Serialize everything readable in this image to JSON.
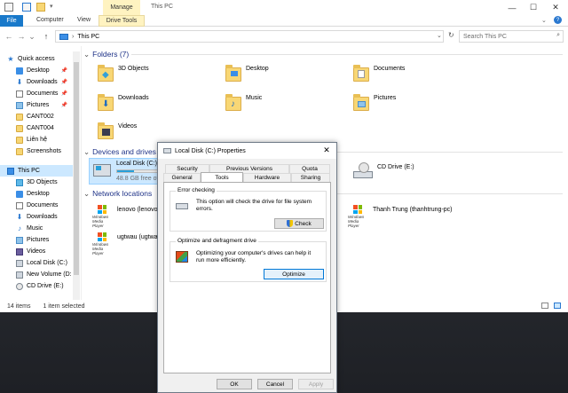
{
  "window": {
    "title": "This PC",
    "manage_label": "Manage",
    "tabs": {
      "file": "File",
      "computer": "Computer",
      "view": "View",
      "drive_tools": "Drive Tools"
    },
    "controls": {
      "minimize": "—",
      "maximize": "☐",
      "close": "✕"
    }
  },
  "nav": {
    "back": "←",
    "forward": "→",
    "recent": "⌄",
    "up": "↑",
    "address_sep": "›",
    "address": "This PC",
    "dropdown": "⌄",
    "refresh": "↻",
    "search_placeholder": "Search This PC"
  },
  "sidebar": {
    "items": [
      {
        "label": "Quick access"
      },
      {
        "label": "Desktop",
        "pin": "📌"
      },
      {
        "label": "Downloads",
        "pin": "📌"
      },
      {
        "label": "Documents",
        "pin": "📌"
      },
      {
        "label": "Pictures",
        "pin": "📌"
      },
      {
        "label": "CANT002"
      },
      {
        "label": "CANT004"
      },
      {
        "label": "Liên hệ"
      },
      {
        "label": "Screenshots"
      },
      {
        "label": "This PC"
      },
      {
        "label": "3D Objects"
      },
      {
        "label": "Desktop"
      },
      {
        "label": "Documents"
      },
      {
        "label": "Downloads"
      },
      {
        "label": "Music"
      },
      {
        "label": "Pictures"
      },
      {
        "label": "Videos"
      },
      {
        "label": "Local Disk (C:)"
      },
      {
        "label": "New Volume (D:"
      },
      {
        "label": "CD Drive (E:)"
      }
    ]
  },
  "content": {
    "folders_header": "Folders (7)",
    "folders": [
      {
        "label": "3D Objects"
      },
      {
        "label": "Desktop"
      },
      {
        "label": "Documents"
      },
      {
        "label": "Downloads"
      },
      {
        "label": "Music"
      },
      {
        "label": "Pictures"
      },
      {
        "label": "Videos"
      }
    ],
    "devices_header": "Devices and drives",
    "drives": [
      {
        "label": "Local Disk (C:)",
        "free": "48.8 GB free of",
        "used_fraction": 0.42
      },
      {
        "label": "CD Drive (E:)"
      }
    ],
    "network_header": "Network locations",
    "network": [
      {
        "label": "lenovo (lenovo"
      },
      {
        "label": "ugtwau (ugtwa"
      },
      {
        "label": "Thanh Trung (thanhtrung-pc)"
      }
    ],
    "media_label_1": "Windows",
    "media_label_2": "Media Player"
  },
  "status": {
    "items": "14 items",
    "selected": "1 item selected"
  },
  "dialog": {
    "title": "Local Disk (C:) Properties",
    "close": "✕",
    "tabs_row1": [
      "Security",
      "Previous Versions",
      "Quota"
    ],
    "tabs_row2": [
      "General",
      "Tools",
      "Hardware",
      "Sharing"
    ],
    "active_tab": "Tools",
    "error_checking": {
      "title": "Error checking",
      "text": "This option will check the drive for file system errors.",
      "button": "Check"
    },
    "optimize": {
      "title": "Optimize and defragment drive",
      "text": "Optimizing your computer's drives can help it run more efficiently.",
      "button": "Optimize"
    },
    "buttons": {
      "ok": "OK",
      "cancel": "Cancel",
      "apply": "Apply"
    }
  }
}
